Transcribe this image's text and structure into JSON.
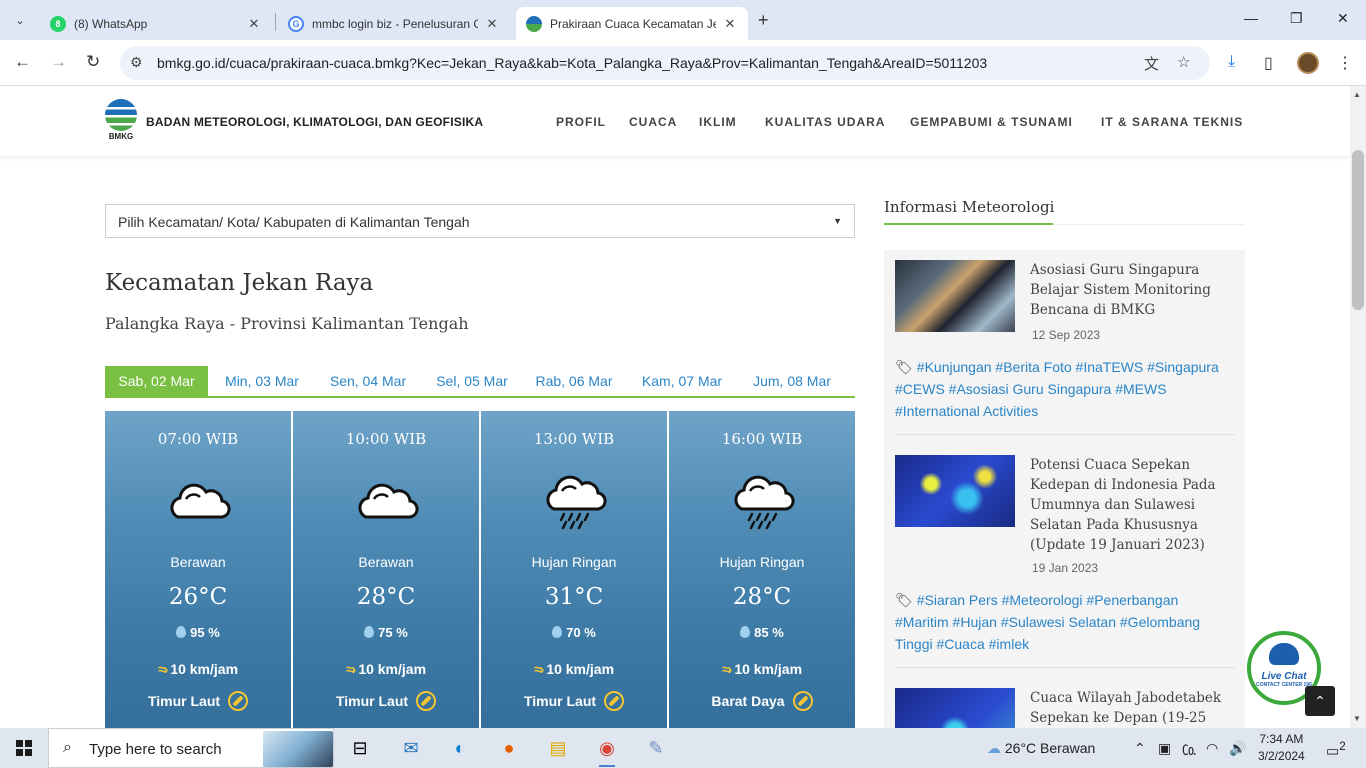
{
  "browser": {
    "tabs": [
      {
        "title": "(8) WhatsApp"
      },
      {
        "title": "mmbc login biz - Penelusuran G"
      },
      {
        "title": "Prakiraan Cuaca Kecamatan Jek"
      }
    ],
    "url": "bmkg.go.id/cuaca/prakiraan-cuaca.bmkg?Kec=Jekan_Raya&kab=Kota_Palangka_Raya&Prov=Kalimantan_Tengah&AreaID=5011203"
  },
  "site": {
    "logo_text": "BMKG",
    "org_name": "BADAN METEOROLOGI, KLIMATOLOGI, DAN GEOFISIKA",
    "nav": [
      "PROFIL",
      "CUACA",
      "IKLIM",
      "KUALITAS UDARA",
      "GEMPABUMI & TSUNAMI",
      "IT & SARANA TEKNIS"
    ]
  },
  "main": {
    "region_select": "Pilih Kecamatan/ Kota/ Kabupaten di Kalimantan Tengah",
    "kecamatan": "Kecamatan Jekan Raya",
    "province_line": "Palangka Raya - Provinsi Kalimantan Tengah",
    "days": [
      "Sab, 02 Mar",
      "Min, 03 Mar",
      "Sen, 04 Mar",
      "Sel, 05 Mar",
      "Rab, 06 Mar",
      "Kam, 07 Mar",
      "Jum, 08 Mar"
    ],
    "forecast": [
      {
        "time": "07:00 WIB",
        "icon": "cloud-icon",
        "condition": "Berawan",
        "temp": "26°C",
        "humidity": "95 %",
        "wind": "10 km/jam",
        "direction": "Timur Laut"
      },
      {
        "time": "10:00 WIB",
        "icon": "cloud-icon",
        "condition": "Berawan",
        "temp": "28°C",
        "humidity": "75 %",
        "wind": "10 km/jam",
        "direction": "Timur Laut"
      },
      {
        "time": "13:00 WIB",
        "icon": "rain-cloud-icon",
        "condition": "Hujan Ringan",
        "temp": "31°C",
        "humidity": "70 %",
        "wind": "10 km/jam",
        "direction": "Timur Laut"
      },
      {
        "time": "16:00 WIB",
        "icon": "rain-cloud-icon",
        "condition": "Hujan Ringan",
        "temp": "28°C",
        "humidity": "85 %",
        "wind": "10 km/jam",
        "direction": "Barat Daya"
      }
    ]
  },
  "sidebar": {
    "title": "Informasi Meteorologi",
    "news": [
      {
        "title": "Asosiasi Guru Singapura Belajar Sistem Monitoring Bencana di BMKG",
        "date": "12 Sep 2023",
        "tags": "#Kunjungan #Berita Foto #InaTEWS #Singapura #CEWS #Asosiasi Guru Singapura #MEWS #International Activities"
      },
      {
        "title": "Potensi Cuaca Sepekan Kedepan di Indonesia Pada Umumnya dan Sulawesi Selatan Pada Khususnya (Update 19 Januari 2023)",
        "date": "19 Jan 2023",
        "tags": "#Siaran Pers #Meteorologi #Penerbangan #Maritim #Hujan #Sulawesi Selatan #Gelombang Tinggi #Cuaca #imlek"
      },
      {
        "title": "Cuaca Wilayah Jabodetabek Sepekan ke Depan (19-25"
      }
    ],
    "livechat": "Live Chat",
    "livechat_sub": "CONTACT CENTER 196"
  },
  "taskbar": {
    "search_placeholder": "Type here to search",
    "weather": "26°C  Berawan",
    "time": "7:34 AM",
    "date": "3/2/2024",
    "notifications": "2"
  },
  "colors": {
    "accent_green": "#7ac143",
    "link_blue": "#2b85c7",
    "card_blue": "#4f8cb5",
    "wind_yellow": "#f6c431"
  }
}
